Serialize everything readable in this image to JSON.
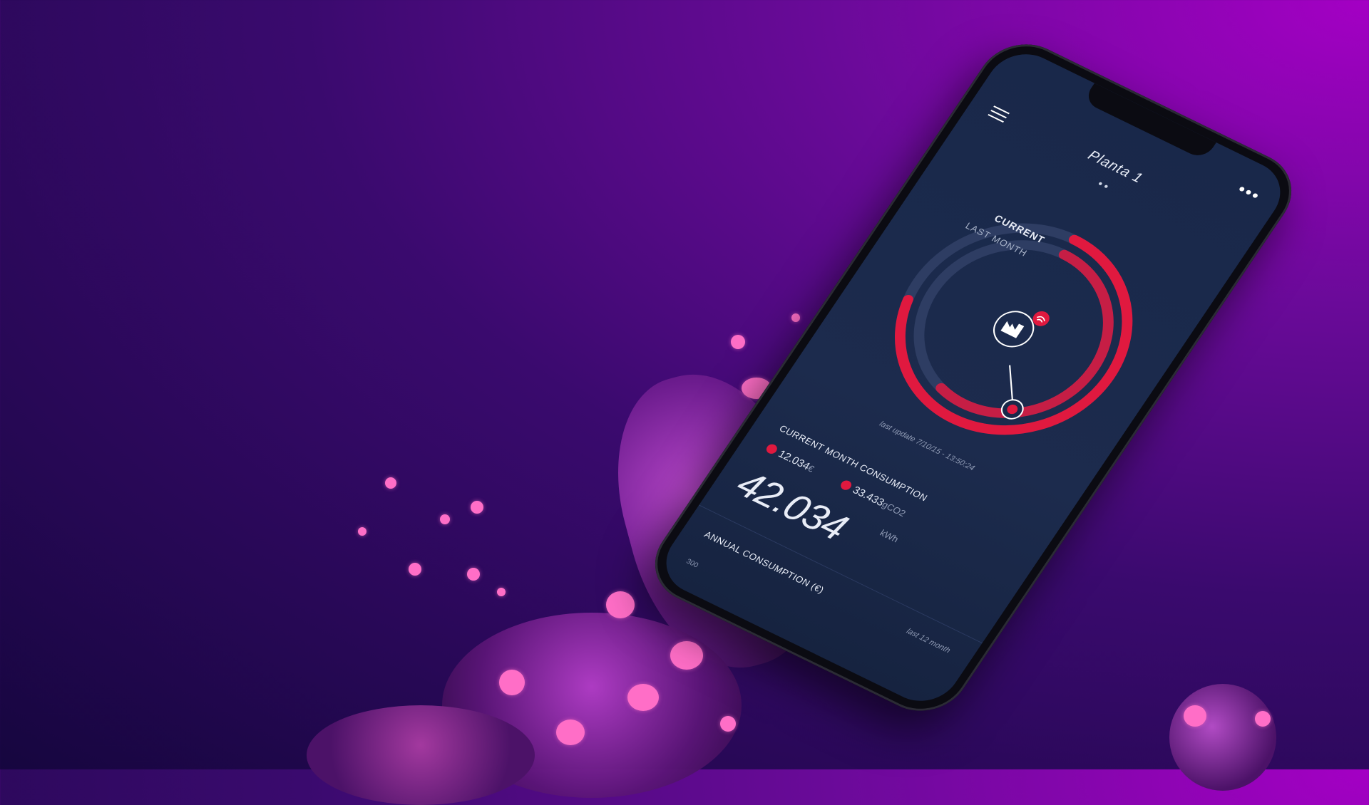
{
  "app": {
    "title": "Planta 1",
    "pager": "● ●",
    "more_icon": "more-horizontal-icon",
    "menu_icon": "menu-icon"
  },
  "gauge": {
    "current_label": "CURRENT",
    "last_month_label": "LAST MONTH",
    "center_icon": "factory-icon",
    "wifi_icon": "wifi-icon",
    "marker_icon": "euro-icon",
    "current_fraction": 0.72,
    "last_month_fraction": 0.55
  },
  "last_update": "last update 7/10/15 - 13:50:24",
  "current_month": {
    "title": "CURRENT MONTH CONSUMPTION",
    "cost_value": "12.034",
    "cost_unit": "€",
    "co2_value": "33.433",
    "co2_unit": "gCO2",
    "energy_value": "42.034",
    "energy_unit": "kWh"
  },
  "annual": {
    "title": "ANNUAL CONSUMPTION (€)",
    "range_label": "last 12 month",
    "axis_tick": "300"
  },
  "colors": {
    "accent": "#e0193f",
    "screen_bg": "#19284a",
    "background_magenta": "#a400c4",
    "background_dark": "#16063f"
  }
}
